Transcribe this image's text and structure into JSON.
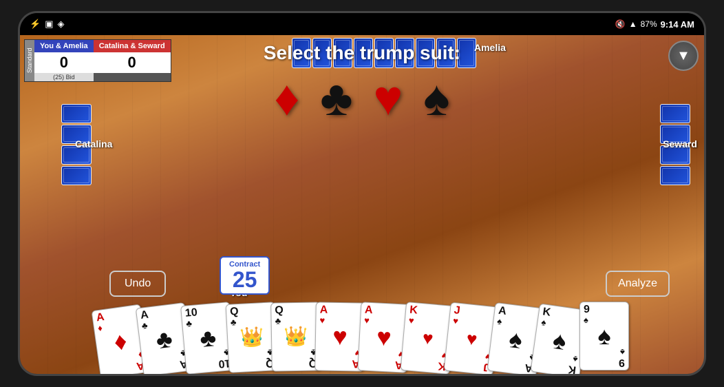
{
  "status_bar": {
    "usb_icon": "⚡",
    "sim_icon": "▣",
    "wifi_icon": "▲",
    "mute_icon": "🔇",
    "signal_icon": "▲",
    "battery_level": "87%",
    "time": "9:14 AM"
  },
  "score": {
    "team1_label": "You & Amelia",
    "team2_label": "Catalina & Seward",
    "team1_score": "0",
    "team2_score": "0",
    "bid_label": "(25)  Bid",
    "mode": "Standard"
  },
  "trump_prompt": "Select the trump suit:",
  "suits": {
    "diamond": "♦",
    "club": "♣",
    "heart": "♥",
    "spade": "♠"
  },
  "players": {
    "top": "Amelia",
    "right": "Seward",
    "left": "Catalina",
    "bottom": "You"
  },
  "contract": {
    "label": "Contract",
    "number": "25"
  },
  "buttons": {
    "undo": "Undo",
    "analyze": "Analyze"
  },
  "hand": [
    {
      "rank": "A",
      "suit": "♦",
      "color": "red",
      "center": "A♦"
    },
    {
      "rank": "A",
      "suit": "♣",
      "color": "black",
      "center": "A♣"
    },
    {
      "rank": "10",
      "suit": "♣",
      "color": "black",
      "center": "10♣"
    },
    {
      "rank": "Q",
      "suit": "♣",
      "color": "black",
      "center": "Q♣"
    },
    {
      "rank": "Q",
      "suit": "♣",
      "color": "black",
      "center": "Q♣"
    },
    {
      "rank": "A",
      "suit": "♥",
      "color": "red",
      "center": "A♥"
    },
    {
      "rank": "A",
      "suit": "♥",
      "color": "red",
      "center": "A♥"
    },
    {
      "rank": "K",
      "suit": "♥",
      "color": "red",
      "center": "K♥"
    },
    {
      "rank": "J",
      "suit": "♥",
      "color": "red",
      "center": "J♥"
    },
    {
      "rank": "A",
      "suit": "♠",
      "color": "black",
      "center": "A♠"
    },
    {
      "rank": "K",
      "suit": "♠",
      "color": "black",
      "center": "K♠"
    },
    {
      "rank": "9",
      "suit": "♠",
      "color": "black",
      "center": "9♠"
    }
  ]
}
